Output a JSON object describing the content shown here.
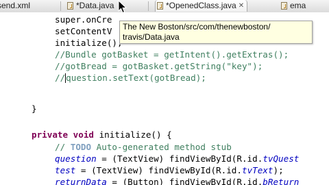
{
  "tabs": [
    {
      "label": "send.xml"
    },
    {
      "label": "*Data.java"
    },
    {
      "label": "*OpenedClass.java"
    },
    {
      "label": "ema"
    }
  ],
  "tooltip": {
    "line1": "The New Boston/src/com/thenewboston/",
    "line2": "travis/Data.java"
  },
  "code": {
    "l1": "super.onCre",
    "l2": "setContentV",
    "l3": "initialize();",
    "l4": "//Bundle gotBasket = getIntent().getExtras();",
    "l5": "//gotBread = gotBasket.getString(\"key\");",
    "l6a": "//",
    "l6b": "question.setText(gotBread);",
    "l8": "}",
    "l10_kw": "private void",
    "l10_rest": " initialize() {",
    "l11_a": "// ",
    "l11_task": "TODO",
    "l11_b": " Auto-generated method stub",
    "l12_f": "question",
    "l12_a": " = (TextView) findViewById(R.id.",
    "l12_g": "tvQuest",
    "l13_f": "test",
    "l13_a": " = (TextView) findViewById(R.id.",
    "l13_g": "tvText",
    "l13_b": ");",
    "l14_f": "returnData",
    "l14_a": " = (Button) findViewById(R.id.",
    "l14_g": "bReturn"
  },
  "colors": {
    "keyword": "#7f0055",
    "comment": "#3f7f5f",
    "field": "#0000c0",
    "string": "#2a00ff",
    "tooltip_bg": "#ffffe1"
  }
}
